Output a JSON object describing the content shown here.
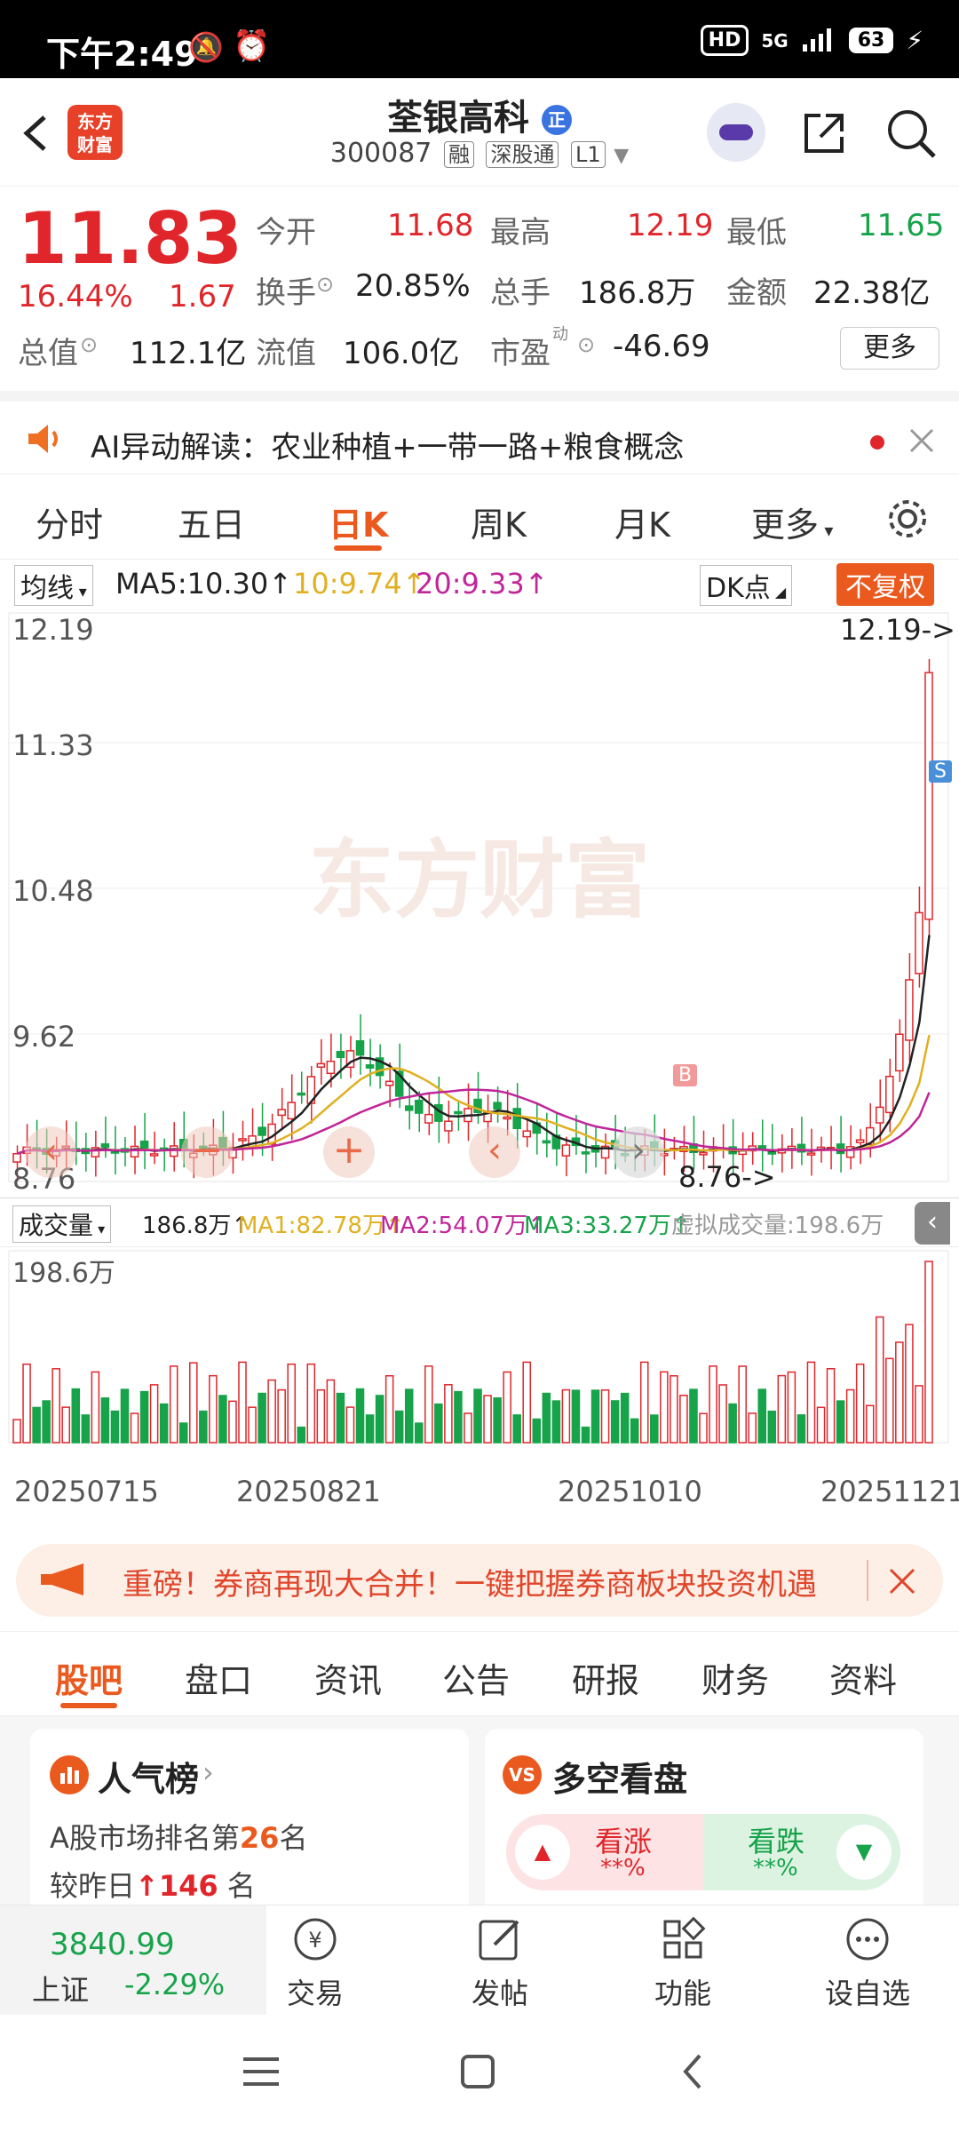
{
  "status_bar": {
    "time": "下午2:49",
    "hd": "HD",
    "network": "5G",
    "battery": "63"
  },
  "header": {
    "logo_line1": "东方",
    "logo_line2": "财富",
    "stock_name": "荃银高科",
    "badge": "正",
    "code": "300087",
    "tags": [
      "融",
      "深股通",
      "L1"
    ]
  },
  "quote": {
    "price": "11.83",
    "change_pct": "16.44%",
    "change_amt": "1.67",
    "open_label": "今开",
    "open": "11.68",
    "high_label": "最高",
    "high": "12.19",
    "low_label": "最低",
    "low": "11.65",
    "turnover_label": "换手",
    "turnover": "20.85%",
    "volume_label": "总手",
    "volume": "186.8万",
    "amount_label": "金额",
    "amount": "22.38亿",
    "mktcap_label": "总值",
    "mktcap": "112.1亿",
    "float_label": "流值",
    "float_val": "106.0亿",
    "pe_label": "市盈",
    "pe_sup": "动",
    "pe": "-46.69",
    "more": "更多"
  },
  "ai_banner": {
    "text": "AI异动解读：农业种植+一带一路+粮食概念"
  },
  "tabs": [
    "分时",
    "五日",
    "日K",
    "周K",
    "月K",
    "更多"
  ],
  "active_tab": 2,
  "ma_bar": {
    "select": "均线",
    "ma5": "MA5:10.30↑",
    "ma10": "10:9.74↑",
    "ma20": "20:9.33↑",
    "dk": "DK点",
    "fq": "不复权",
    "colors": {
      "ma5": "#222222",
      "ma10": "#e0b020",
      "ma20": "#c0259a"
    }
  },
  "chart_data": {
    "type": "candlestick",
    "price_axis_labels": [
      "12.19",
      "11.33",
      "10.48",
      "9.62",
      "8.76"
    ],
    "price_range": [
      8.76,
      12.19
    ],
    "max_marker": "12.19->",
    "min_marker": "8.76->",
    "watermark": "东方财富",
    "buy_marker": "B",
    "sell_marker": "S",
    "volume_select": "成交量",
    "volume_legend": [
      "186.8万↑",
      "MA1:82.78万↑",
      "MA2:54.07万↑",
      "MA3:33.27万↑",
      "虚拟成交量:198.6万"
    ],
    "volume_max_label": "198.6万",
    "dates": [
      "20250715",
      "20250821",
      "20251010",
      "20251121"
    ]
  },
  "notice": {
    "text": "重磅！券商再现大合并！一键把握券商板块投资机遇"
  },
  "sub_tabs": [
    "股吧",
    "盘口",
    "资讯",
    "公告",
    "研报",
    "财务",
    "资料"
  ],
  "cards": {
    "popularity": {
      "title": "人气榜",
      "line1_pre": "A股市场排名第",
      "line1_num": "26",
      "line1_suf": "名",
      "line2_pre": "较昨日",
      "line2_num": "146",
      "line2_suf": " 名"
    },
    "sentiment": {
      "title": "多空看盘",
      "up_label": "看涨",
      "up_val": "**%",
      "down_label": "看跌",
      "down_val": "**%"
    }
  },
  "bottom_nav": {
    "index_value": "3840.99",
    "index_name": "上证",
    "index_change": "-2.29%",
    "items": [
      "交易",
      "发帖",
      "功能",
      "设自选"
    ]
  }
}
